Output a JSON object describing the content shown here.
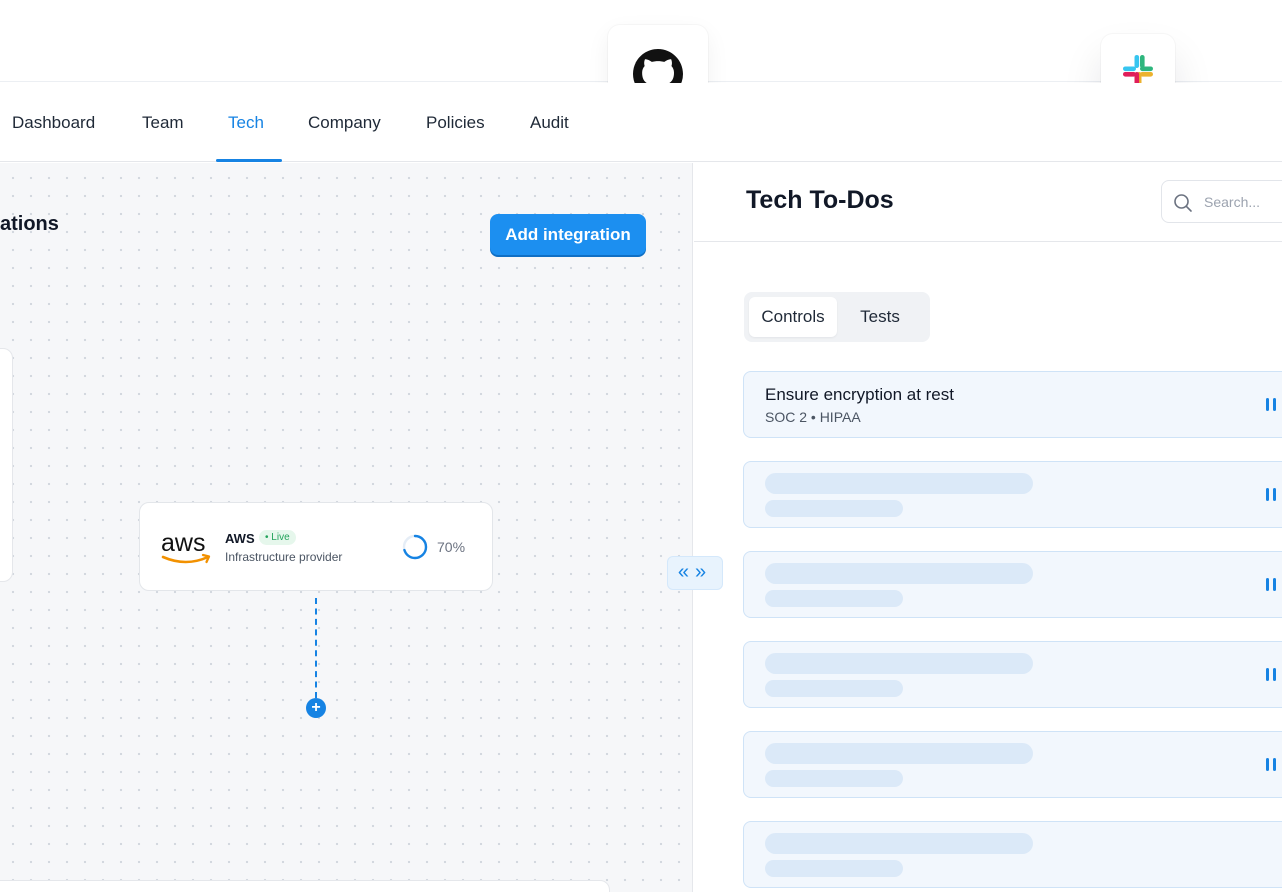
{
  "nav": {
    "items": [
      {
        "label": "Dashboard"
      },
      {
        "label": "Team"
      },
      {
        "label": "Tech"
      },
      {
        "label": "Company"
      },
      {
        "label": "Policies"
      },
      {
        "label": "Audit"
      }
    ],
    "active": "Tech"
  },
  "floating_integrations": [
    "github-icon",
    "slack-icon"
  ],
  "canvas": {
    "title": "ations",
    "add_button": "Add integration",
    "integration_card": {
      "logo_text": "aws",
      "name": "AWS",
      "status": "• Live",
      "description": "Infrastructure provider",
      "progress_label": "70%",
      "progress": 0.7
    },
    "add_node_symbol": "+",
    "collapse_toggle": "«»"
  },
  "panel": {
    "title": "Tech To-Dos",
    "search": {
      "placeholder": "Search...",
      "value": ""
    },
    "tabs": [
      {
        "label": "Controls"
      },
      {
        "label": "Tests"
      }
    ],
    "active_tab": "Controls",
    "todos": [
      {
        "title": "Ensure encryption at rest",
        "subtitle": "SOC 2 • HIPAA"
      }
    ],
    "placeholder_rows": 5
  },
  "colors": {
    "accent": "#1683e3",
    "button": "#1c8ff0",
    "live_green": "#22a35a",
    "aws_orange": "#f29100"
  }
}
